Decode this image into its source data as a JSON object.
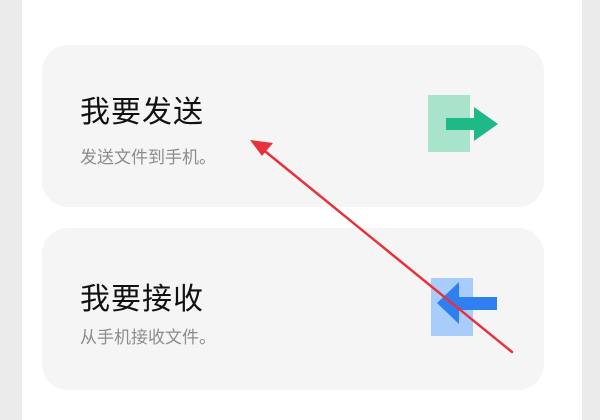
{
  "send_card": {
    "title": "我要发送",
    "subtitle": "发送文件到手机。",
    "icon": "send-file-icon",
    "box_color": "#a8e3cc",
    "arrow_color": "#1fb887"
  },
  "receive_card": {
    "title": "我要接收",
    "subtitle": "从手机接收文件。",
    "icon": "receive-file-icon",
    "box_color": "#a9cdfa",
    "arrow_color": "#2f7ff0"
  },
  "annotation": {
    "arrow_color": "#e8313c"
  }
}
